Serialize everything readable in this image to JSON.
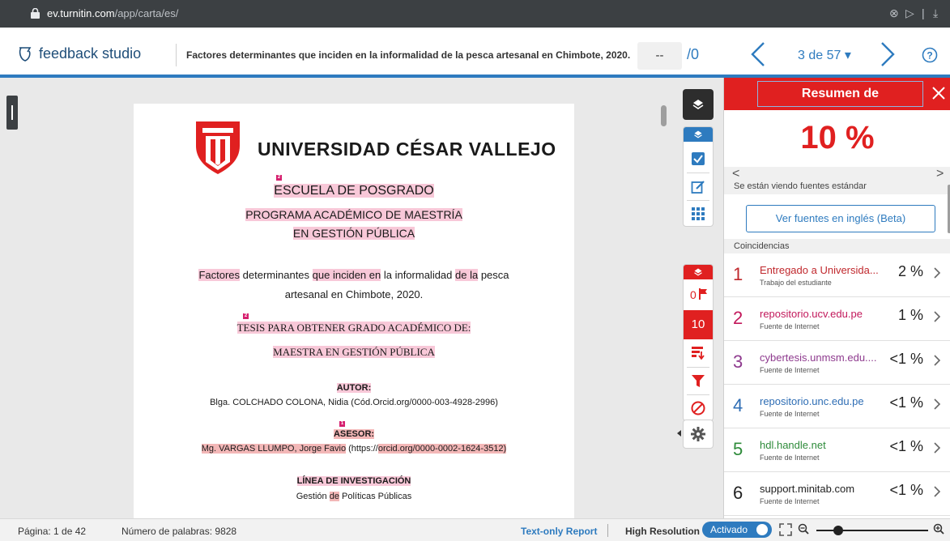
{
  "browser": {
    "url_host": "ev.turnitin.com",
    "url_path": "/app/carta/es/"
  },
  "header": {
    "logo_text": "feedback studio",
    "doc_title": "Factores determinantes que inciden en la informalidad de la pesca artesanal en Chimbote, 2020.",
    "score_value": "--",
    "score_total": "/0",
    "page_label": "3 de 57 ▾"
  },
  "document": {
    "university": "UNIVERSIDAD CÉSAR VALLEJO",
    "school": "ESCUELA DE POSGRADO",
    "program_1": "PROGRAMA ACADÉMICO DE MAESTRÍA",
    "program_2": "EN GESTIÓN PÚBLICA",
    "title_w1": "Factores",
    "title_w2": " determinantes ",
    "title_w3": "que inciden en",
    "title_w4": " la informalidad ",
    "title_w5": "de la",
    "title_w6": " pesca",
    "title_line2": "artesanal en Chimbote, 2020.",
    "thesis_1": "TESIS PARA OBTENER GRADO ACADÉMICO DE:",
    "thesis_2": "MAESTRA EN GESTIÓN PÚBLICA",
    "author_label": "AUTOR:",
    "author_value": "Blga. COLCHADO COLONA, Nidia (Cód.Orcid.org/0000-003-4928-2996)",
    "advisor_label": "ASESOR:",
    "advisor_name": "Mg. VARGAS LLUMPO, Jorge Favio",
    "advisor_mid": " (https://",
    "advisor_orcid": "orcid.org/0000-0002-1624-3512)",
    "line_label": "LÍNEA DE INVESTIGACIÓN",
    "line_w1": "Gestión ",
    "line_w2": "de",
    "line_w3": " Políticas Públicas",
    "marker_1": "2",
    "marker_2": "2",
    "marker_3": "1"
  },
  "tools": {
    "flag_count": "0",
    "match_count": "10"
  },
  "panel": {
    "title": "Resumen de coincidencias",
    "percent": "10 %",
    "viewing_text": "Se están viendo fuentes estándar",
    "english_button": "Ver fuentes en inglés (Beta)",
    "matches_label": "Coincidencias",
    "matches": [
      {
        "num": "1",
        "name": "Entregado a Universida...",
        "type": "Trabajo del estudiante",
        "pct": "2 %",
        "color": "#c0282d"
      },
      {
        "num": "2",
        "name": "repositorio.ucv.edu.pe",
        "type": "Fuente de Internet",
        "pct": "1 %",
        "color": "#c2185b"
      },
      {
        "num": "3",
        "name": "cybertesis.unmsm.edu....",
        "type": "Fuente de Internet",
        "pct": "<1 %",
        "color": "#8e3a8e"
      },
      {
        "num": "4",
        "name": "repositorio.unc.edu.pe",
        "type": "Fuente de Internet",
        "pct": "<1 %",
        "color": "#2e6db4"
      },
      {
        "num": "5",
        "name": "hdl.handle.net",
        "type": "Fuente de Internet",
        "pct": "<1 %",
        "color": "#2e8b3a"
      },
      {
        "num": "6",
        "name": "support.minitab.com",
        "type": "Fuente de Internet",
        "pct": "<1 %",
        "color": "#222222"
      }
    ]
  },
  "status": {
    "page_info": "Página: 1 de 42",
    "word_count": "Número de palabras: 9828",
    "text_only": "Text-only Report",
    "high_res": "High Resolution",
    "toggle_label": "Activado"
  },
  "colors": {
    "accent_blue": "#2e7bbf",
    "match_red": "#e02020",
    "highlight": "#f8c8d8"
  }
}
